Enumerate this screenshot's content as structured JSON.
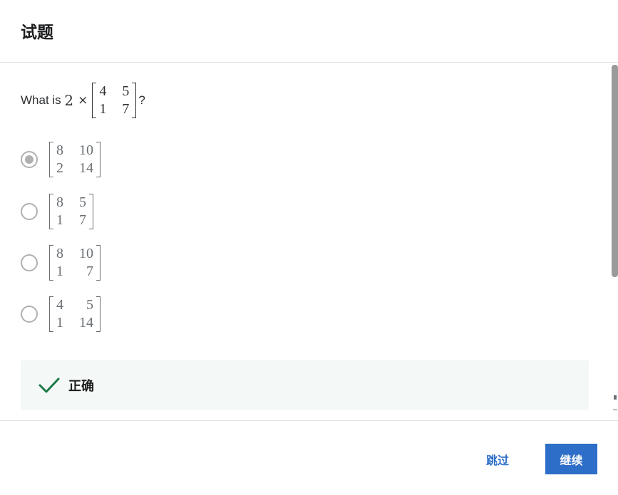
{
  "header": {
    "title": "试题"
  },
  "question": {
    "prefix": "What is ",
    "scalar": "2",
    "times": "×",
    "suffix": "?",
    "matrix": [
      [
        "4",
        "5"
      ],
      [
        "1",
        "7"
      ]
    ]
  },
  "options": [
    {
      "matrix": [
        [
          "8",
          "10"
        ],
        [
          "2",
          "14"
        ]
      ],
      "selected": true
    },
    {
      "matrix": [
        [
          "8",
          "5"
        ],
        [
          "1",
          "7"
        ]
      ],
      "selected": false
    },
    {
      "matrix": [
        [
          "8",
          "10"
        ],
        [
          "1",
          "7"
        ]
      ],
      "selected": false
    },
    {
      "matrix": [
        [
          "4",
          "5"
        ],
        [
          "1",
          "14"
        ]
      ],
      "selected": false
    }
  ],
  "feedback": {
    "icon": "checkmark-icon",
    "text": "正确",
    "color": "#1e7a4a"
  },
  "footer": {
    "skip_label": "跳过",
    "continue_label": "继续"
  },
  "colors": {
    "accent": "#2d6ec8",
    "feedback_bg": "#f4f8f6"
  }
}
